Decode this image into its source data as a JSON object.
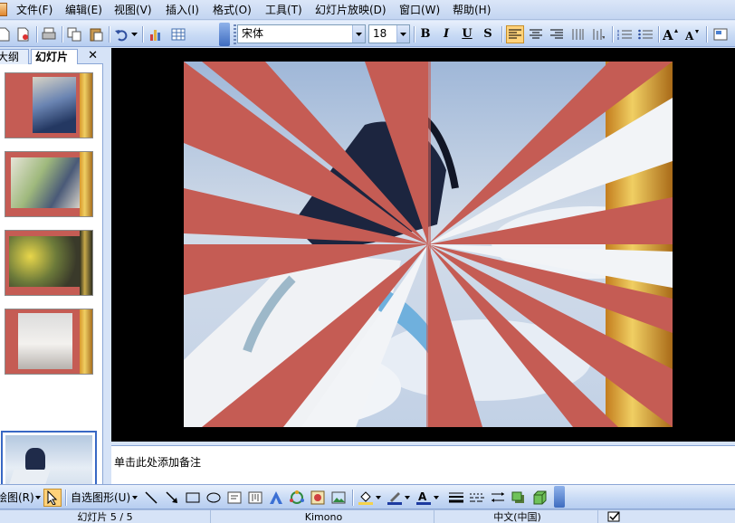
{
  "menu": {
    "items": [
      "文件(F)",
      "编辑(E)",
      "视图(V)",
      "插入(I)",
      "格式(O)",
      "工具(T)",
      "幻灯片放映(D)",
      "窗口(W)",
      "帮助(H)"
    ]
  },
  "toolbar": {
    "font_name": "宋体",
    "font_size": "18",
    "bold_label": "B",
    "italic_label": "I",
    "underline_label": "U",
    "shadow_label": "S",
    "icons": [
      "new-icon",
      "permission-icon",
      "print-icon",
      "copy-icon",
      "paste-icon",
      "undo-icon",
      "chart-icon",
      "table-icon",
      "bold-icon",
      "italic-icon",
      "underline-icon",
      "shadow-icon",
      "align-left-icon",
      "align-center-icon",
      "align-right-icon",
      "text-direction-icon",
      "numbering-icon",
      "bullets-icon",
      "increase-font-icon",
      "decrease-font-icon"
    ]
  },
  "left_pane": {
    "tab_outline": "大纲",
    "tab_slides": "幻灯片",
    "close_label": "✕",
    "selected_slide": 5,
    "slide_count": 5
  },
  "slide": {
    "background_color": "#c55c54",
    "accent_colors": [
      "#c55c54",
      "#e8a33c",
      "#6fa3d8"
    ]
  },
  "notes": {
    "placeholder": "单击此处添加备注"
  },
  "drawbar": {
    "draw_label": "绘图(R)",
    "autoshapes_label": "自选图形(U)",
    "icons": [
      "pointer-icon",
      "line-icon",
      "arrow-icon",
      "rectangle-icon",
      "oval-icon",
      "textbox-icon",
      "vertical-textbox-icon",
      "wordart-icon",
      "diagram-icon",
      "clipart-icon",
      "picture-icon",
      "fill-color-icon",
      "line-color-icon",
      "font-color-icon",
      "line-style-icon",
      "dash-style-icon",
      "arrow-style-icon",
      "shadow-style-icon",
      "3d-style-icon"
    ]
  },
  "status": {
    "slide_position": "幻灯片 5 / 5",
    "template": "Kimono",
    "language": "中文(中国)"
  }
}
